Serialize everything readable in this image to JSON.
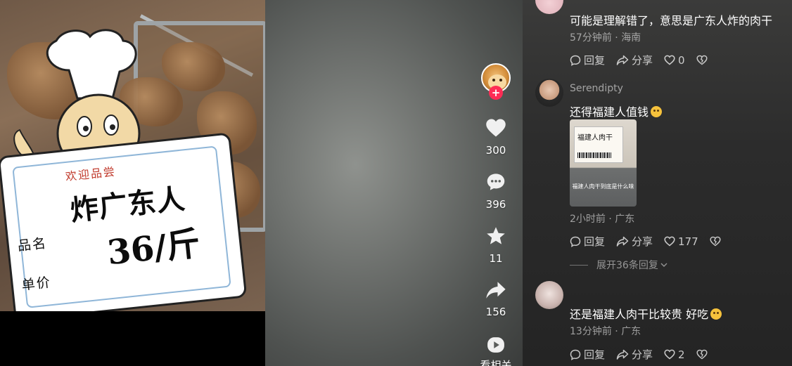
{
  "video": {
    "sign_welcome": "欢迎品尝",
    "sign_product_label": "品名",
    "sign_price_label": "单价",
    "sign_product": "炸广东人",
    "sign_price": "36/斤"
  },
  "actions": {
    "like_count": "300",
    "comment_count": "396",
    "favorite_count": "11",
    "share_count": "156",
    "related_label": "看相关",
    "follow_symbol": "+"
  },
  "comments": [
    {
      "text": "可能是理解错了，意思是广东人炸的肉干",
      "time": "57分钟前",
      "location": "海南",
      "reply_label": "回复",
      "share_label": "分享",
      "likes": "0"
    },
    {
      "username": "Serendipty",
      "text": "还得福建人值钱",
      "image_title": "福建人肉干",
      "image_caption": "福建人肉干到底是什么味",
      "time": "2小时前",
      "location": "广东",
      "reply_label": "回复",
      "share_label": "分享",
      "likes": "177",
      "expand_label": "展开36条回复"
    },
    {
      "text": "还是福建人肉干比较贵 好吃",
      "time": "13分钟前",
      "location": "广东",
      "reply_label": "回复",
      "share_label": "分享",
      "likes": "2"
    }
  ],
  "meta_separator": " · ",
  "colors": {
    "accent": "#fe2c55",
    "panel_bg": "#2c2c2c",
    "muted_text": "rgba(255,255,255,0.55)"
  }
}
